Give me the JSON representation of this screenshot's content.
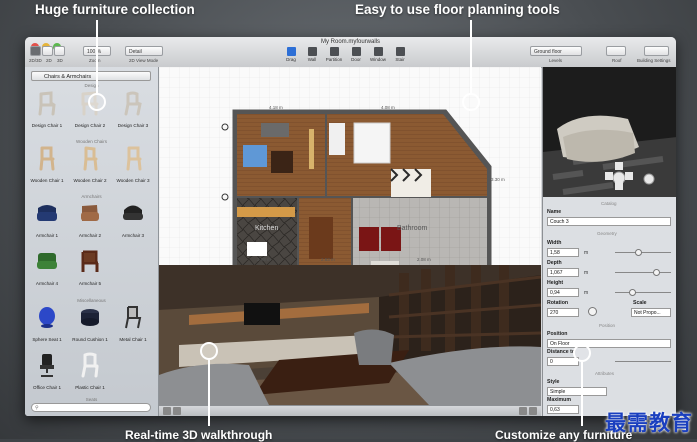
{
  "callouts": {
    "top_left": "Huge furniture collection",
    "top_center": "Easy to use floor planning tools",
    "bottom_left": "Real-time 3D walkthrough",
    "bottom_right": "Customize any furniture"
  },
  "window": {
    "title": "My Room.myfourwalls",
    "view_modes": [
      "2D/3D",
      "2D",
      "3D"
    ],
    "zoom": "100 %",
    "zoom_label": "Zoom",
    "detail": "Detail",
    "detail_label": "2D View Mode",
    "tools": [
      "Drag",
      "Wall",
      "Partition",
      "Door",
      "Window",
      "Stair"
    ],
    "level_select": "Ground floor",
    "level_label": "Levels",
    "roof_label": "Roof",
    "building_settings_label": "Building Settings"
  },
  "sidebar": {
    "category": "Chairs & Armchairs",
    "sections": [
      {
        "title": "Design",
        "items": [
          "Design Chair 1",
          "Design Chair 2",
          "Design Chair 3"
        ]
      },
      {
        "title": "Wooden Chairs",
        "items": [
          "Wooden Chair 1",
          "Wooden Chair 2",
          "Wooden Chair 3"
        ]
      },
      {
        "title": "Armchairs",
        "items": [
          "Armchair 1",
          "Armchair 2",
          "Armchair 3",
          "Armchair 4",
          "Armchair 5"
        ]
      },
      {
        "title": "Miscellaneous",
        "items": [
          "Sphere Seat 1",
          "Round Cushion 1",
          "Metal Chair 1",
          "Office Chair 1",
          "Plastic Chair 1"
        ]
      }
    ],
    "bottom_label": "Seats"
  },
  "plan": {
    "dims": [
      "4.18 m",
      "4.08 m",
      "2.98 m",
      "2.53 m",
      "2.08 m",
      "3.30 m"
    ],
    "kitchen": "Kitchen",
    "bathroom": "Bathroom"
  },
  "inspector": {
    "catalog_label": "Catalog",
    "name_label": "Name",
    "name_value": "Couch 3",
    "geometry_label": "Geometry",
    "width_label": "Width",
    "width_value": "1,58",
    "depth_label": "Depth",
    "depth_value": "1,067",
    "height_label": "Height",
    "height_value": "0,94",
    "unit": "m",
    "rotation_label": "Rotation",
    "rotation_value": "270",
    "scale_label": "Scale",
    "scale_value": "Not Propo...",
    "position_section": "Position",
    "position_label": "Position",
    "position_value": "On Floor",
    "distance_label": "Distance to",
    "distance_value": "0",
    "attributes_section": "Attributes",
    "style_label": "Style",
    "style_value": "Simple",
    "maximum_label": "Maximum",
    "maximum_value": "0,63"
  },
  "watermark": "最需教育",
  "colors": {
    "accent": "#3b7ad9",
    "wood": "#7a4a2a"
  }
}
